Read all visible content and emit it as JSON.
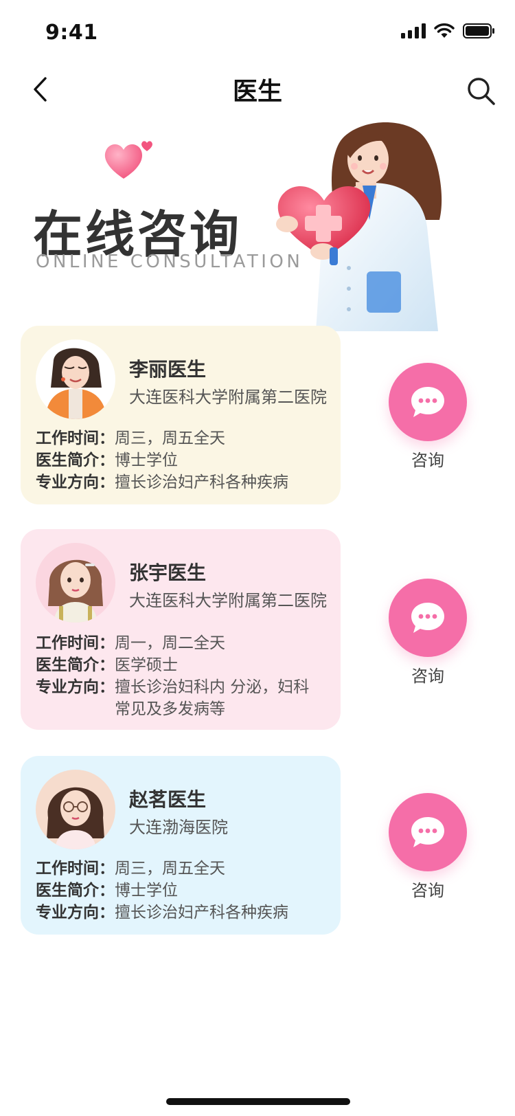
{
  "status_bar": {
    "time": "9:41"
  },
  "nav": {
    "title": "医生"
  },
  "hero": {
    "title": "在线咨询",
    "subtitle": "ONLINE CONSULTATION"
  },
  "colors": {
    "accent": "#f56ea8",
    "card_yellow": "#fbf6e4",
    "card_pink": "#fde7ee",
    "card_blue": "#e3f5fd"
  },
  "labels": {
    "work_time": "工作时间：",
    "intro": "医生简介：",
    "specialty": "专业方向：",
    "consult": "咨询"
  },
  "doctors": [
    {
      "name": "李丽医生",
      "hospital": "大连医科大学附属第二医院",
      "work_time": "周三，周五全天",
      "intro": "博士学位",
      "specialty": "擅长诊治妇产科各种疾病"
    },
    {
      "name": "张宇医生",
      "hospital": "大连医科大学附属第二医院",
      "work_time": "周一，周二全天",
      "intro": "医学硕士",
      "specialty": "擅长诊治妇科内 分泌，妇科常见及多发病等"
    },
    {
      "name": "赵茗医生",
      "hospital": "大连渤海医院",
      "work_time": "周三，周五全天",
      "intro": "博士学位",
      "specialty": "擅长诊治妇产科各种疾病"
    }
  ]
}
